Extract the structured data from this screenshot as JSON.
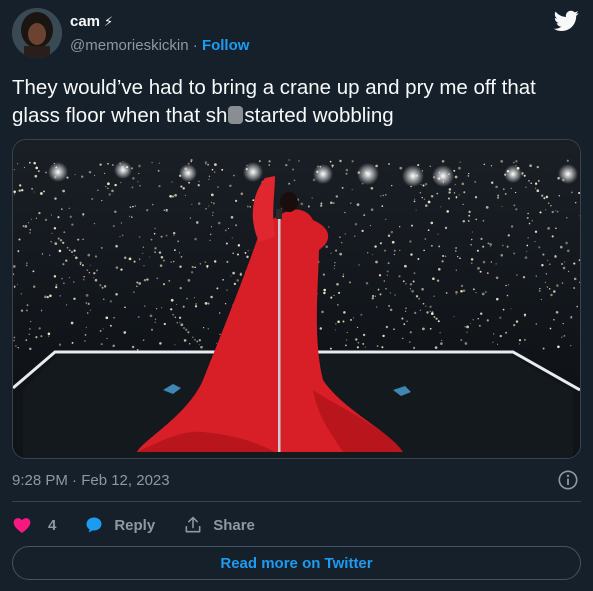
{
  "author": {
    "display_name": "cam",
    "badge_icon": "lightning-bolt-icon",
    "badge_glyph": "⚡",
    "handle": "@memorieskickin",
    "separator": " · ",
    "follow_label": "Follow"
  },
  "tweet": {
    "text_before_censor": "They would’ve had to bring a crane up and pry me off that glass floor when that sh",
    "text_after_censor": "started wobbling",
    "timestamp": "9:28 PM · Feb 12, 2023"
  },
  "actions": {
    "like_count": "4",
    "reply_label": "Reply",
    "share_label": "Share"
  },
  "read_more_label": "Read more on Twitter",
  "colors": {
    "background": "#15202b",
    "accent": "#1d9bf0",
    "like": "#f91880",
    "muted": "#8b98a5",
    "performer_red": "#d81e26"
  }
}
